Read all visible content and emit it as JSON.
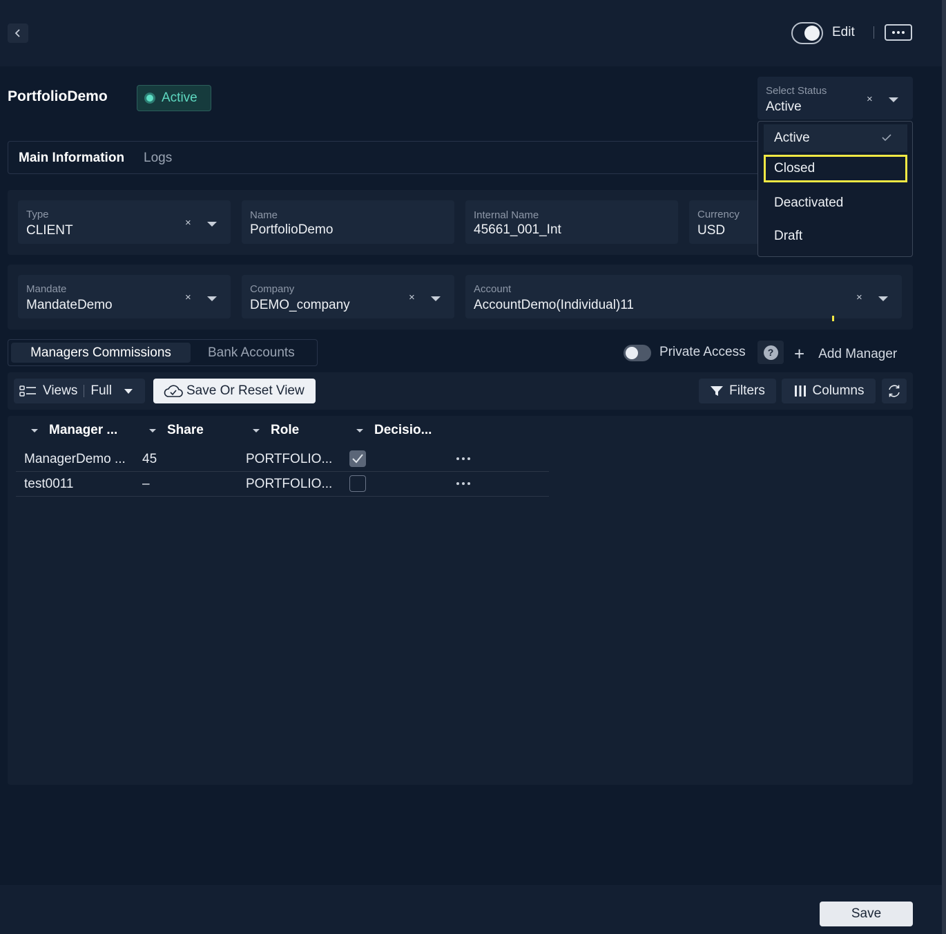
{
  "header": {
    "edit_label": "Edit"
  },
  "page": {
    "title": "PortfolioDemo",
    "status_badge": "Active",
    "status_color": "#5ed8c0"
  },
  "status_select": {
    "label": "Select Status",
    "value": "Active",
    "options": [
      "Active",
      "Closed",
      "Deactivated",
      "Draft"
    ],
    "selected_index": 0,
    "highlighted_index": 1
  },
  "tabs": [
    {
      "label": "Main Information"
    },
    {
      "label": "Logs"
    }
  ],
  "fields_row1": [
    {
      "label": "Type",
      "value": "CLIENT"
    },
    {
      "label": "Name",
      "value": "PortfolioDemo"
    },
    {
      "label": "Internal Name",
      "value": "45661_001_Int"
    },
    {
      "label": "Currency",
      "value": "USD"
    }
  ],
  "fields_row2": [
    {
      "label": "Mandate",
      "value": "MandateDemo"
    },
    {
      "label": "Company",
      "value": "DEMO_company"
    },
    {
      "label": "Account",
      "value": "AccountDemo(Individual)11"
    }
  ],
  "subtabs": [
    {
      "label": "Managers Commissions"
    },
    {
      "label": "Bank Accounts"
    }
  ],
  "private_access": {
    "label": "Private Access",
    "help": "?"
  },
  "add_manager": {
    "label": "Add Manager",
    "plus": "+"
  },
  "toolbar": {
    "views_label": "Views",
    "views_value": "Full",
    "save_view_label": "Save Or Reset View",
    "filters_label": "Filters",
    "columns_label": "Columns"
  },
  "table": {
    "columns": [
      "Manager ...",
      "Share",
      "Role",
      "Decisio..."
    ],
    "rows": [
      {
        "manager": "ManagerDemo ...",
        "share": "45",
        "role": "PORTFOLIO...",
        "decision": true
      },
      {
        "manager": "test0011",
        "share": "–",
        "role": "PORTFOLIO...",
        "decision": false
      }
    ]
  },
  "footer": {
    "save_label": "Save"
  },
  "icons": {
    "back": "chevron-left-icon",
    "more": "ellipsis-icon",
    "check": "check-icon",
    "clear": "close-icon",
    "caret": "caret-down-icon",
    "views": "list-icon",
    "save_view": "cloud-check-icon",
    "filters": "funnel-icon",
    "columns": "columns-icon",
    "refresh": "refresh-icon"
  }
}
